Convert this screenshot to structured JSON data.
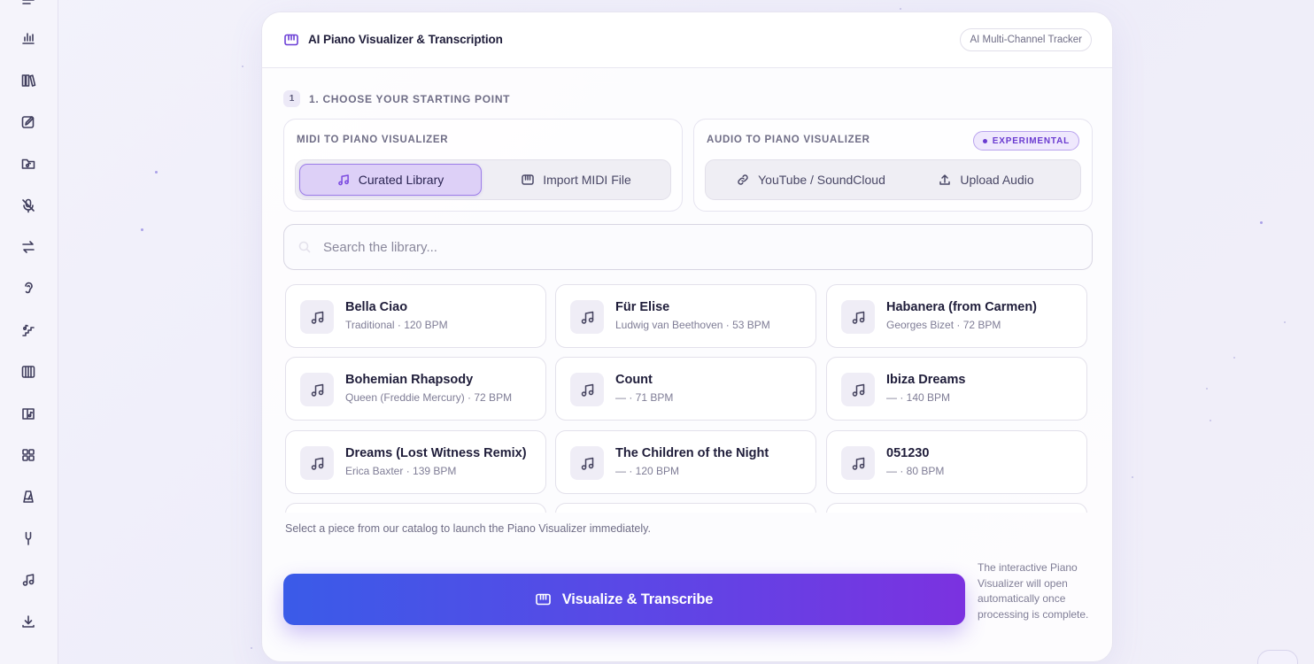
{
  "header": {
    "title": "AI Piano Visualizer & Transcription",
    "pill": "AI Multi-Channel Tracker"
  },
  "step": {
    "number": "1",
    "label": "1. CHOOSE YOUR STARTING POINT"
  },
  "midi_panel": {
    "title": "MIDI TO PIANO VISUALIZER",
    "tabs": [
      {
        "label": "Curated Library",
        "icon": "music-note-icon",
        "active": true
      },
      {
        "label": "Import MIDI File",
        "icon": "piano-icon",
        "active": false
      }
    ]
  },
  "audio_panel": {
    "title": "AUDIO TO PIANO VISUALIZER",
    "badge": "EXPERIMENTAL",
    "tabs": [
      {
        "label": "YouTube / SoundCloud",
        "icon": "link-icon"
      },
      {
        "label": "Upload Audio",
        "icon": "upload-icon"
      }
    ]
  },
  "search": {
    "placeholder": "Search the library..."
  },
  "library": [
    {
      "title": "Bella Ciao",
      "subtitle": "Traditional · 120 BPM"
    },
    {
      "title": "Für Elise",
      "subtitle": "Ludwig van Beethoven · 53 BPM"
    },
    {
      "title": "Habanera (from Carmen)",
      "subtitle": "Georges Bizet · 72 BPM"
    },
    {
      "title": "Bohemian Rhapsody",
      "subtitle": "Queen (Freddie Mercury) · 72 BPM"
    },
    {
      "title": "Count",
      "subtitle": "— · 71 BPM"
    },
    {
      "title": "Ibiza Dreams",
      "subtitle": "— · 140 BPM"
    },
    {
      "title": "Dreams (Lost Witness Remix)",
      "subtitle": "Erica Baxter · 139 BPM"
    },
    {
      "title": "The Children of the Night",
      "subtitle": "— · 120 BPM"
    },
    {
      "title": "051230",
      "subtitle": "— · 80 BPM"
    },
    {
      "title": "",
      "subtitle": ""
    },
    {
      "title": "",
      "subtitle": ""
    },
    {
      "title": "",
      "subtitle": ""
    }
  ],
  "hint": "Select a piece from our catalog to launch the Piano Visualizer immediately.",
  "cta": {
    "label": "Visualize & Transcribe",
    "note": "The interactive Piano Visualizer will open automatically once processing is complete."
  },
  "sidebar": {
    "items": [
      "menu-icon",
      "bar-chart-icon",
      "library-icon",
      "edit-icon",
      "folder-music-icon",
      "mic-off-icon",
      "swap-icon",
      "ear-icon",
      "steps-icon",
      "piano-keys-icon",
      "book-music-icon",
      "grid-icon",
      "metronome-icon",
      "tuning-fork-icon",
      "music-icon",
      "download-icon"
    ]
  },
  "colors": {
    "accent": "#6b3fd6",
    "cta_start": "#3a5be8",
    "cta_end": "#7b32e0",
    "active_tab_bg": "#ddd0f7"
  }
}
